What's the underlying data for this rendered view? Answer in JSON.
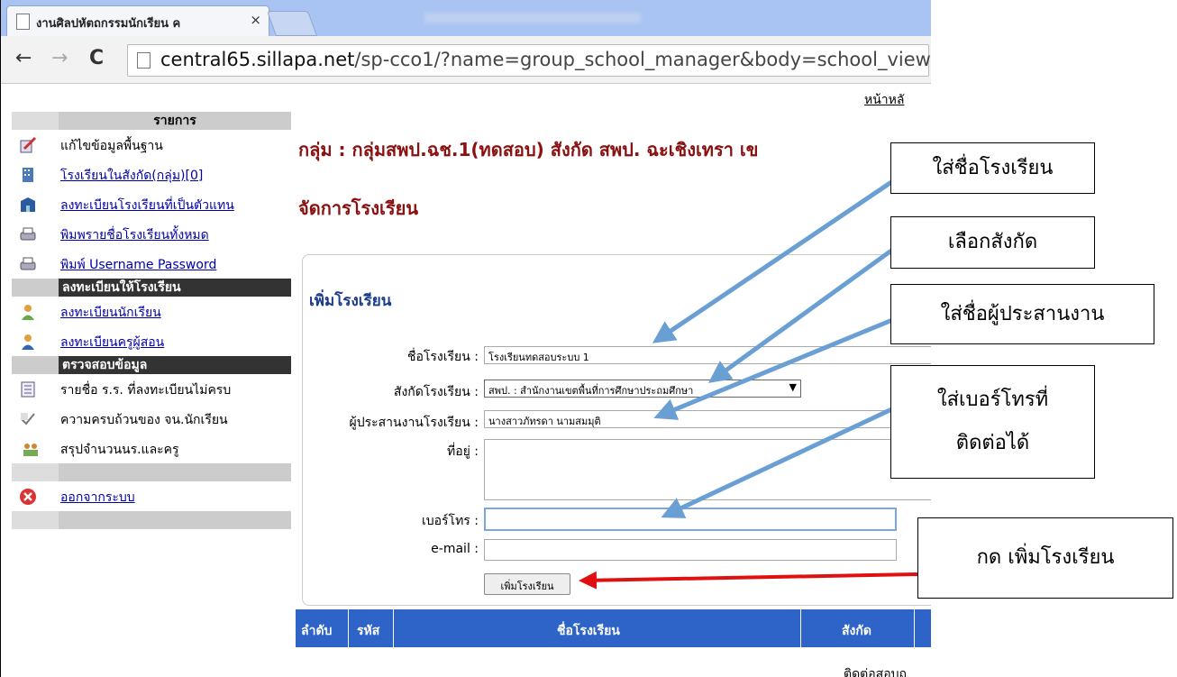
{
  "browser": {
    "tab_title": "งานศิลปหัตถกรรมนักเรียน ค",
    "tab_close": "×",
    "url_host": "central65.sillapa.net",
    "url_path": "/sp-cco1/?name=group_school_manager&body=school_view"
  },
  "header": {
    "home_link": "หน้าหลั"
  },
  "sidebar": {
    "heading": "รายการ",
    "items": [
      {
        "label": "แก้ไขข้อมูลพื้นฐาน",
        "icon": "edit-icon",
        "link": false
      },
      {
        "label": "โรงเรียนในสังกัด(กลุ่ม)[0]",
        "icon": "building-icon",
        "link": true
      },
      {
        "label": "ลงทะเบียนโรงเรียนที่เป็นตัวแทน",
        "icon": "school-register-icon",
        "link": true
      },
      {
        "label": "พิมพรายชื่อโรงเรียนทั้งหมด",
        "icon": "printer-icon",
        "link": true
      },
      {
        "label": "พิมพ์ Username Password",
        "icon": "printer-icon",
        "link": true
      }
    ],
    "section2": "ลงทะเบียนให้โรงเรียน",
    "items2": [
      {
        "label": "ลงทะเบียนนักเรียน",
        "icon": "student-icon"
      },
      {
        "label": "ลงทะเบียนครูผู้สอน",
        "icon": "teacher-icon"
      }
    ],
    "section3": "ตรวจสอบข้อมูล",
    "items3": [
      {
        "label": "รายชื่อ ร.ร. ที่ลงทะเบียนไม่ครบ",
        "icon": "list-icon"
      },
      {
        "label": "ความครบถ้วนของ จน.นักเรียน",
        "icon": "check-icon"
      },
      {
        "label": "สรุปจำนวนนร.และครู",
        "icon": "people-icon"
      }
    ],
    "logout": "ออกจากระบบ"
  },
  "main": {
    "group_title": "กลุ่ม : กลุ่มสพป.ฉช.1(ทดสอบ) สังกัด สพป. ฉะเชิงเทรา เข",
    "manage_title": "จัดการโรงเรียน",
    "panel_title": "เพิ่มโรงเรียน",
    "form": {
      "school_name_label": "ชื่อโรงเรียน :",
      "school_name_value": "โรงเรียนทดสอบระบบ 1",
      "affiliation_label": "สังกัดโรงเรียน :",
      "affiliation_value": "สพป. : สำนักงานเขตพื้นที่การศึกษาประถมศึกษา",
      "coordinator_label": "ผู้ประสานงานโรงเรียน :",
      "coordinator_value": "นางสาวภัทรดา นามสมมุติ",
      "address_label": "ที่อยู่ :",
      "address_value": "",
      "phone_label": "เบอร์โทร :",
      "phone_value": "",
      "email_label": "e-mail :",
      "email_value": "",
      "submit_label": "เพิ่มโรงเรียน"
    },
    "table_headers": [
      "ลำดับ",
      "รหัส",
      "ชื่อโรงเรียน",
      "สังกัด"
    ]
  },
  "footer": {
    "text": "ติดต่อสอบถ"
  },
  "callouts": {
    "school_name": "ใส่ชื่อโรงเรียน",
    "affiliation": "เลือกสังกัด",
    "coordinator": "ใส่ชื่อผู้ประสานงาน",
    "phone_line1": "ใส่เบอร์โทรที่",
    "phone_line2": "ติดต่อได้",
    "submit": "กด เพิ่มโรงเรียน"
  },
  "colors": {
    "title_red": "#8b1010",
    "arrow_blue": "#6a9fd4",
    "arrow_red": "#e01010",
    "table_header": "#2e64c8"
  }
}
